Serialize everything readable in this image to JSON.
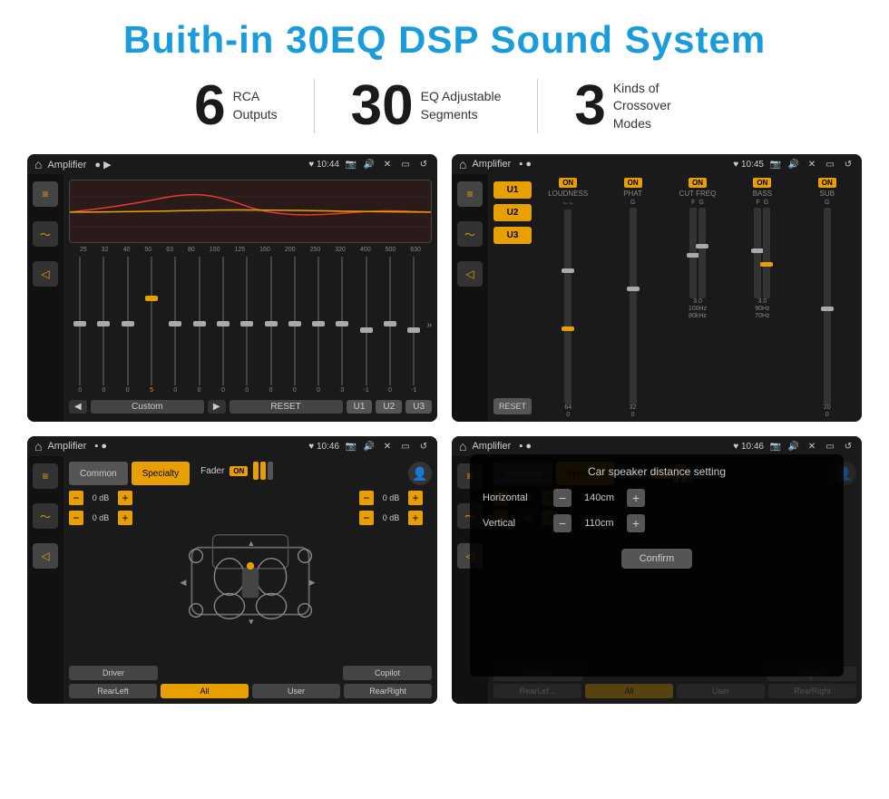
{
  "title": "Buith-in 30EQ DSP Sound System",
  "stats": [
    {
      "number": "6",
      "label": "RCA\nOutputs"
    },
    {
      "number": "30",
      "label": "EQ Adjustable\nSegments"
    },
    {
      "number": "3",
      "label": "Kinds of\nCrossover Modes"
    }
  ],
  "screens": [
    {
      "id": "screen1",
      "app": "Amplifier",
      "time": "10:44",
      "description": "30-band EQ screen"
    },
    {
      "id": "screen2",
      "app": "Amplifier",
      "time": "10:45",
      "description": "Amplifier channel settings"
    },
    {
      "id": "screen3",
      "app": "Amplifier",
      "time": "10:46",
      "description": "Speaker placement"
    },
    {
      "id": "screen4",
      "app": "Amplifier",
      "time": "10:46",
      "description": "Distance setting dialog"
    }
  ],
  "eq_freqs": [
    "25",
    "32",
    "40",
    "50",
    "63",
    "80",
    "100",
    "125",
    "160",
    "200",
    "250",
    "320",
    "400",
    "500",
    "630"
  ],
  "eq_values": [
    "0",
    "0",
    "0",
    "5",
    "0",
    "0",
    "0",
    "0",
    "0",
    "0",
    "0",
    "0",
    "-1",
    "0",
    "-1"
  ],
  "eq_labels": [
    "Custom",
    "RESET",
    "U1",
    "U2",
    "U3"
  ],
  "amp_channels": [
    {
      "label": "LOUDNESS",
      "on": true
    },
    {
      "label": "PHAT",
      "on": true
    },
    {
      "label": "CUT FREQ",
      "on": true
    },
    {
      "label": "BASS",
      "on": true
    },
    {
      "label": "SUB",
      "on": true
    }
  ],
  "speaker": {
    "tabs": [
      "Common",
      "Specialty"
    ],
    "fader_label": "Fader",
    "fader_on": "ON",
    "db_values": [
      "0 dB",
      "0 dB",
      "0 dB",
      "0 dB"
    ],
    "bottom_btns": [
      "Driver",
      "Copilot",
      "RearLeft",
      "All",
      "User",
      "RearRight"
    ]
  },
  "distance": {
    "title": "Car speaker distance setting",
    "horizontal_label": "Horizontal",
    "horizontal_value": "140cm",
    "vertical_label": "Vertical",
    "vertical_value": "110cm",
    "confirm_label": "Confirm"
  }
}
